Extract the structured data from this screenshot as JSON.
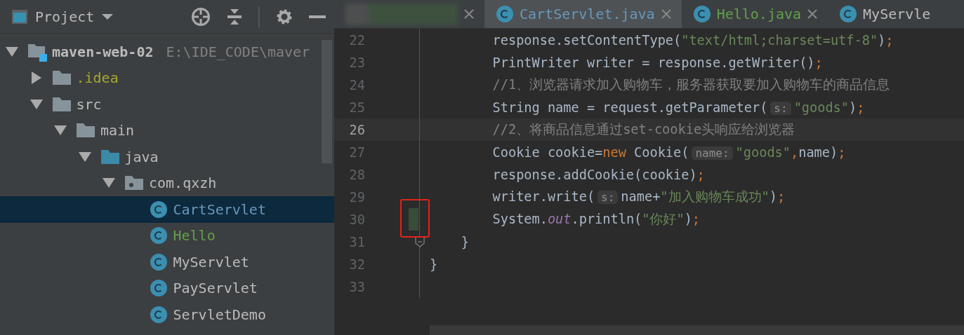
{
  "project_panel": {
    "title": "Project",
    "tree": [
      {
        "label": "maven-web-02",
        "path": "E:\\IDE_CODE\\maver",
        "kind": "module",
        "expanded": true,
        "selected": false,
        "color": "#bbbbbb",
        "children": [
          {
            "label": ".idea",
            "kind": "folder",
            "expanded": false,
            "selected": false,
            "color": "#a8a82d"
          },
          {
            "label": "src",
            "kind": "folder",
            "expanded": true,
            "selected": false,
            "color": "#bbbbbb",
            "children": [
              {
                "label": "main",
                "kind": "folder",
                "expanded": true,
                "selected": false,
                "color": "#bbbbbb",
                "children": [
                  {
                    "label": "java",
                    "kind": "source-folder",
                    "expanded": true,
                    "selected": false,
                    "color": "#bbbbbb",
                    "children": [
                      {
                        "label": "com.qxzh",
                        "kind": "package",
                        "expanded": true,
                        "selected": false,
                        "color": "#bbbbbb",
                        "children": [
                          {
                            "label": "CartServlet",
                            "kind": "class",
                            "selected": true,
                            "color": "#6897bb"
                          },
                          {
                            "label": "Hello",
                            "kind": "class",
                            "selected": false,
                            "color": "#62a04a"
                          },
                          {
                            "label": "MyServlet",
                            "kind": "class",
                            "selected": false,
                            "color": "#bbbbbb"
                          },
                          {
                            "label": "PayServlet",
                            "kind": "class",
                            "selected": false,
                            "color": "#bbbbbb"
                          },
                          {
                            "label": "ServletDemo",
                            "kind": "class",
                            "selected": false,
                            "color": "#bbbbbb"
                          }
                        ]
                      }
                    ]
                  }
                ]
              }
            ]
          }
        ]
      }
    ]
  },
  "editor": {
    "tabs": [
      {
        "kind": "blurred",
        "selected": false
      },
      {
        "kind": "file",
        "label": "CartServlet.java",
        "selected": true,
        "color": "#6897bb"
      },
      {
        "kind": "file",
        "label": "Hello.java",
        "selected": false,
        "color": "#62a04a"
      },
      {
        "kind": "file",
        "label": "MyServle",
        "selected": false,
        "color": "#bbbbbb"
      }
    ],
    "lines": [
      {
        "number": "22",
        "current": false,
        "changed": false,
        "fold": false,
        "tokens": [
          {
            "kind": "text",
            "text": "        response.setContentType("
          },
          {
            "kind": "string",
            "text": "\"text/html;charset=utf-8\""
          },
          {
            "kind": "text",
            "text": ")"
          },
          {
            "kind": "punct",
            "text": ";"
          }
        ]
      },
      {
        "number": "23",
        "current": false,
        "changed": false,
        "fold": false,
        "tokens": [
          {
            "kind": "text",
            "text": "        PrintWriter writer = response.getWriter()"
          },
          {
            "kind": "punct",
            "text": ";"
          }
        ]
      },
      {
        "number": "24",
        "current": false,
        "changed": false,
        "fold": false,
        "tokens": [
          {
            "kind": "comment",
            "text": "        //1、浏览器请求加入购物车，服务器获取要加入购物车的商品信息"
          }
        ]
      },
      {
        "number": "25",
        "current": false,
        "changed": false,
        "fold": false,
        "tokens": [
          {
            "kind": "text",
            "text": "        String name = request.getParameter("
          },
          {
            "kind": "hint",
            "text": "s:"
          },
          {
            "kind": "string",
            "text": "\"goods\""
          },
          {
            "kind": "text",
            "text": ")"
          },
          {
            "kind": "punct",
            "text": ";"
          }
        ]
      },
      {
        "number": "26",
        "current": true,
        "changed": false,
        "fold": false,
        "tokens": [
          {
            "kind": "comment",
            "text": "        //2、将商品信息通过set-cookie头响应给浏览器"
          }
        ]
      },
      {
        "number": "27",
        "current": false,
        "changed": false,
        "fold": false,
        "tokens": [
          {
            "kind": "text",
            "text": "        Cookie cookie="
          },
          {
            "kind": "keyword",
            "text": "new"
          },
          {
            "kind": "text",
            "text": " Cookie("
          },
          {
            "kind": "hint",
            "text": "name:"
          },
          {
            "kind": "string",
            "text": "\"goods\""
          },
          {
            "kind": "punct",
            "text": ","
          },
          {
            "kind": "text",
            "text": "name)"
          },
          {
            "kind": "punct",
            "text": ";"
          }
        ]
      },
      {
        "number": "28",
        "current": false,
        "changed": false,
        "fold": false,
        "tokens": [
          {
            "kind": "text",
            "text": "        response.addCookie(cookie)"
          },
          {
            "kind": "punct",
            "text": ";"
          }
        ]
      },
      {
        "number": "29",
        "current": false,
        "changed": false,
        "fold": false,
        "tokens": [
          {
            "kind": "text",
            "text": "        writer.write("
          },
          {
            "kind": "hint",
            "text": "s:"
          },
          {
            "kind": "text",
            "text": "name+"
          },
          {
            "kind": "string",
            "text": "\"加入购物车成功\""
          },
          {
            "kind": "text",
            "text": ")"
          },
          {
            "kind": "punct",
            "text": ";"
          }
        ]
      },
      {
        "number": "30",
        "current": false,
        "changed": true,
        "fold": false,
        "tokens": [
          {
            "kind": "text",
            "text": "        System."
          },
          {
            "kind": "static",
            "text": "out"
          },
          {
            "kind": "text",
            "text": ".println("
          },
          {
            "kind": "string",
            "text": "\"你好\""
          },
          {
            "kind": "text",
            "text": ")"
          },
          {
            "kind": "punct",
            "text": ";"
          }
        ]
      },
      {
        "number": "31",
        "current": false,
        "changed": false,
        "fold": true,
        "tokens": [
          {
            "kind": "text",
            "text": "    }"
          }
        ]
      },
      {
        "number": "32",
        "current": false,
        "changed": false,
        "fold": false,
        "tokens": [
          {
            "kind": "text",
            "text": "}"
          }
        ]
      },
      {
        "number": "33",
        "current": false,
        "changed": false,
        "fold": false
      }
    ]
  }
}
